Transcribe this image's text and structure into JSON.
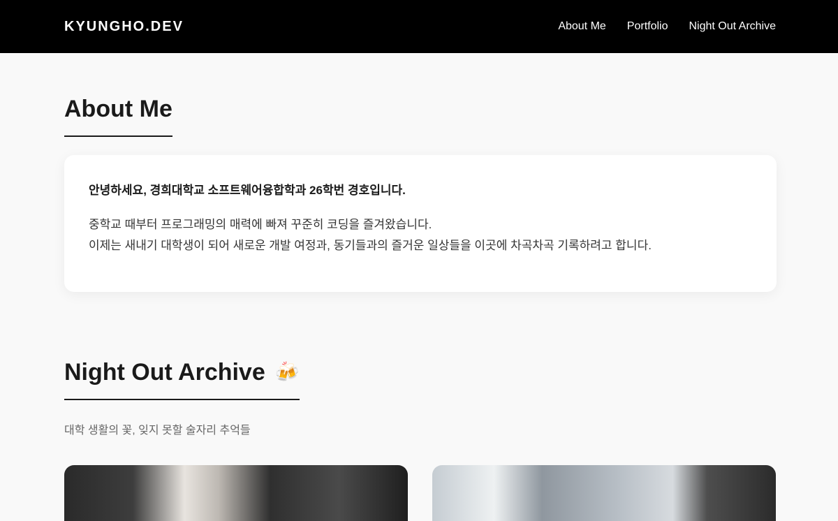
{
  "header": {
    "logo": "KYUNGHO.DEV",
    "nav": [
      {
        "label": "About Me"
      },
      {
        "label": "Portfolio"
      },
      {
        "label": "Night Out Archive"
      }
    ]
  },
  "about": {
    "title": "About Me",
    "intro": "안녕하세요, 경희대학교 소프트웨어융합학과 26학번 경호입니다.",
    "body_line1": "중학교 때부터 프로그래밍의 매력에 빠져 꾸준히 코딩을 즐겨왔습니다.",
    "body_line2": "이제는 새내기 대학생이 되어 새로운 개발 여정과, 동기들과의 즐거운 일상들을 이곳에 차곡차곡 기록하려고 합니다."
  },
  "night_out": {
    "title": "Night Out Archive",
    "emoji": "🍻",
    "icon": "beer-mugs-icon",
    "subtitle": "대학 생활의 꽃, 잊지 못할 술자리 추억들"
  },
  "colors": {
    "header_bg": "#000000",
    "page_bg": "#f9f9f9",
    "card_bg": "#ffffff",
    "text": "#1a1a1a",
    "muted": "#666666"
  }
}
